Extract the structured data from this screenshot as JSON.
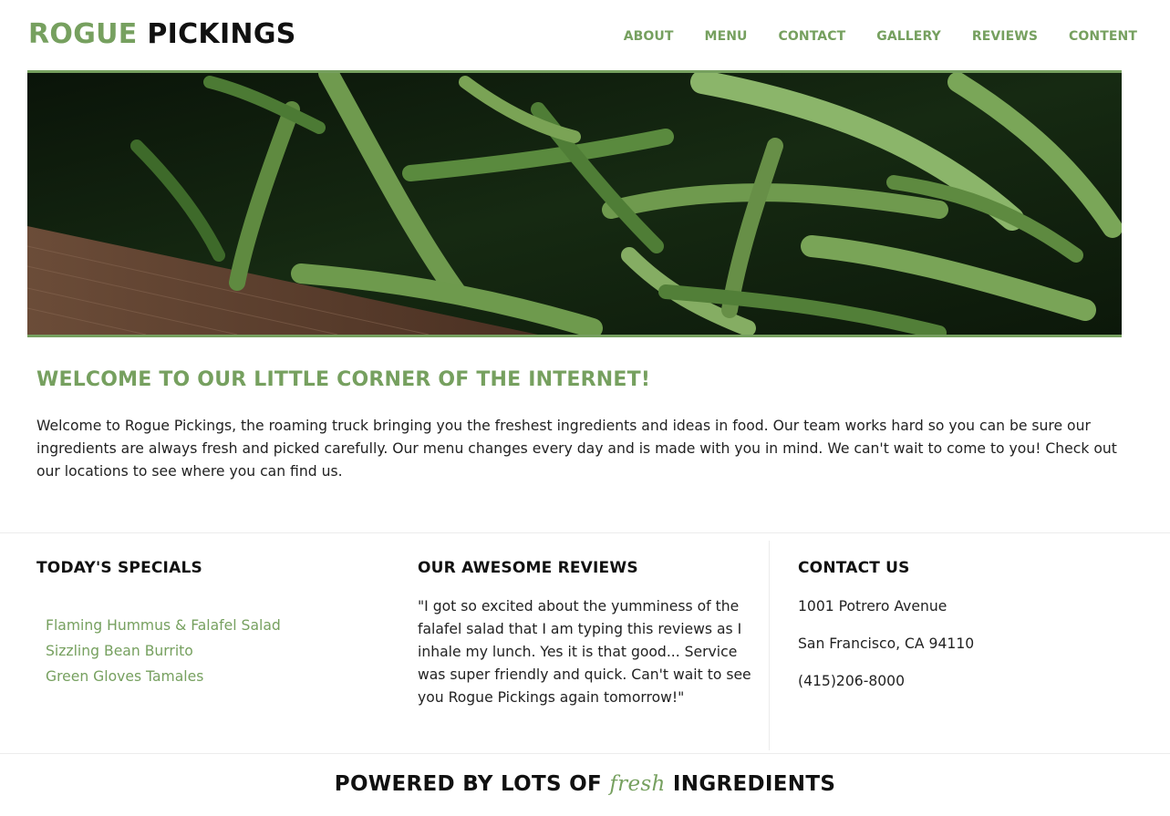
{
  "colors": {
    "accent": "#76a05f",
    "text": "#222222",
    "heading": "#111111"
  },
  "header": {
    "logo_part1": "ROGUE",
    "logo_part2": "PICKINGS",
    "nav": [
      "ABOUT",
      "MENU",
      "CONTACT",
      "GALLERY",
      "REVIEWS",
      "CONTENT"
    ]
  },
  "hero": {
    "icon": "green-beans-photo"
  },
  "welcome": {
    "title": "WELCOME TO OUR LITTLE CORNER OF THE INTERNET!",
    "text": "Welcome to Rogue Pickings, the roaming truck bringing you the freshest ingredients and ideas in food. Our team works hard so you can be sure our ingredients are always fresh and picked carefully. Our menu changes every day and is made with you in mind. We can't wait to come to you! Check out our locations to see where you can find us."
  },
  "specials": {
    "title": "TODAY'S SPECIALS",
    "items": [
      "Flaming Hummus & Falafel Salad",
      "Sizzling Bean Burrito",
      "Green Gloves Tamales"
    ]
  },
  "reviews": {
    "title": "OUR AWESOME REVIEWS",
    "text": "\"I got so excited about the yumminess of the falafel salad that I am typing this reviews as I inhale my lunch. Yes it is that good... Service was super friendly and quick. Can't wait to see you Rogue Pickings again tomorrow!\""
  },
  "contact": {
    "title": "CONTACT US",
    "street": "1001 Potrero Avenue",
    "city": "San Francisco, CA 94110",
    "phone": "(415)206-8000"
  },
  "footer": {
    "before": "POWERED BY LOTS OF",
    "fresh": "fresh",
    "after": "INGREDIENTS"
  }
}
